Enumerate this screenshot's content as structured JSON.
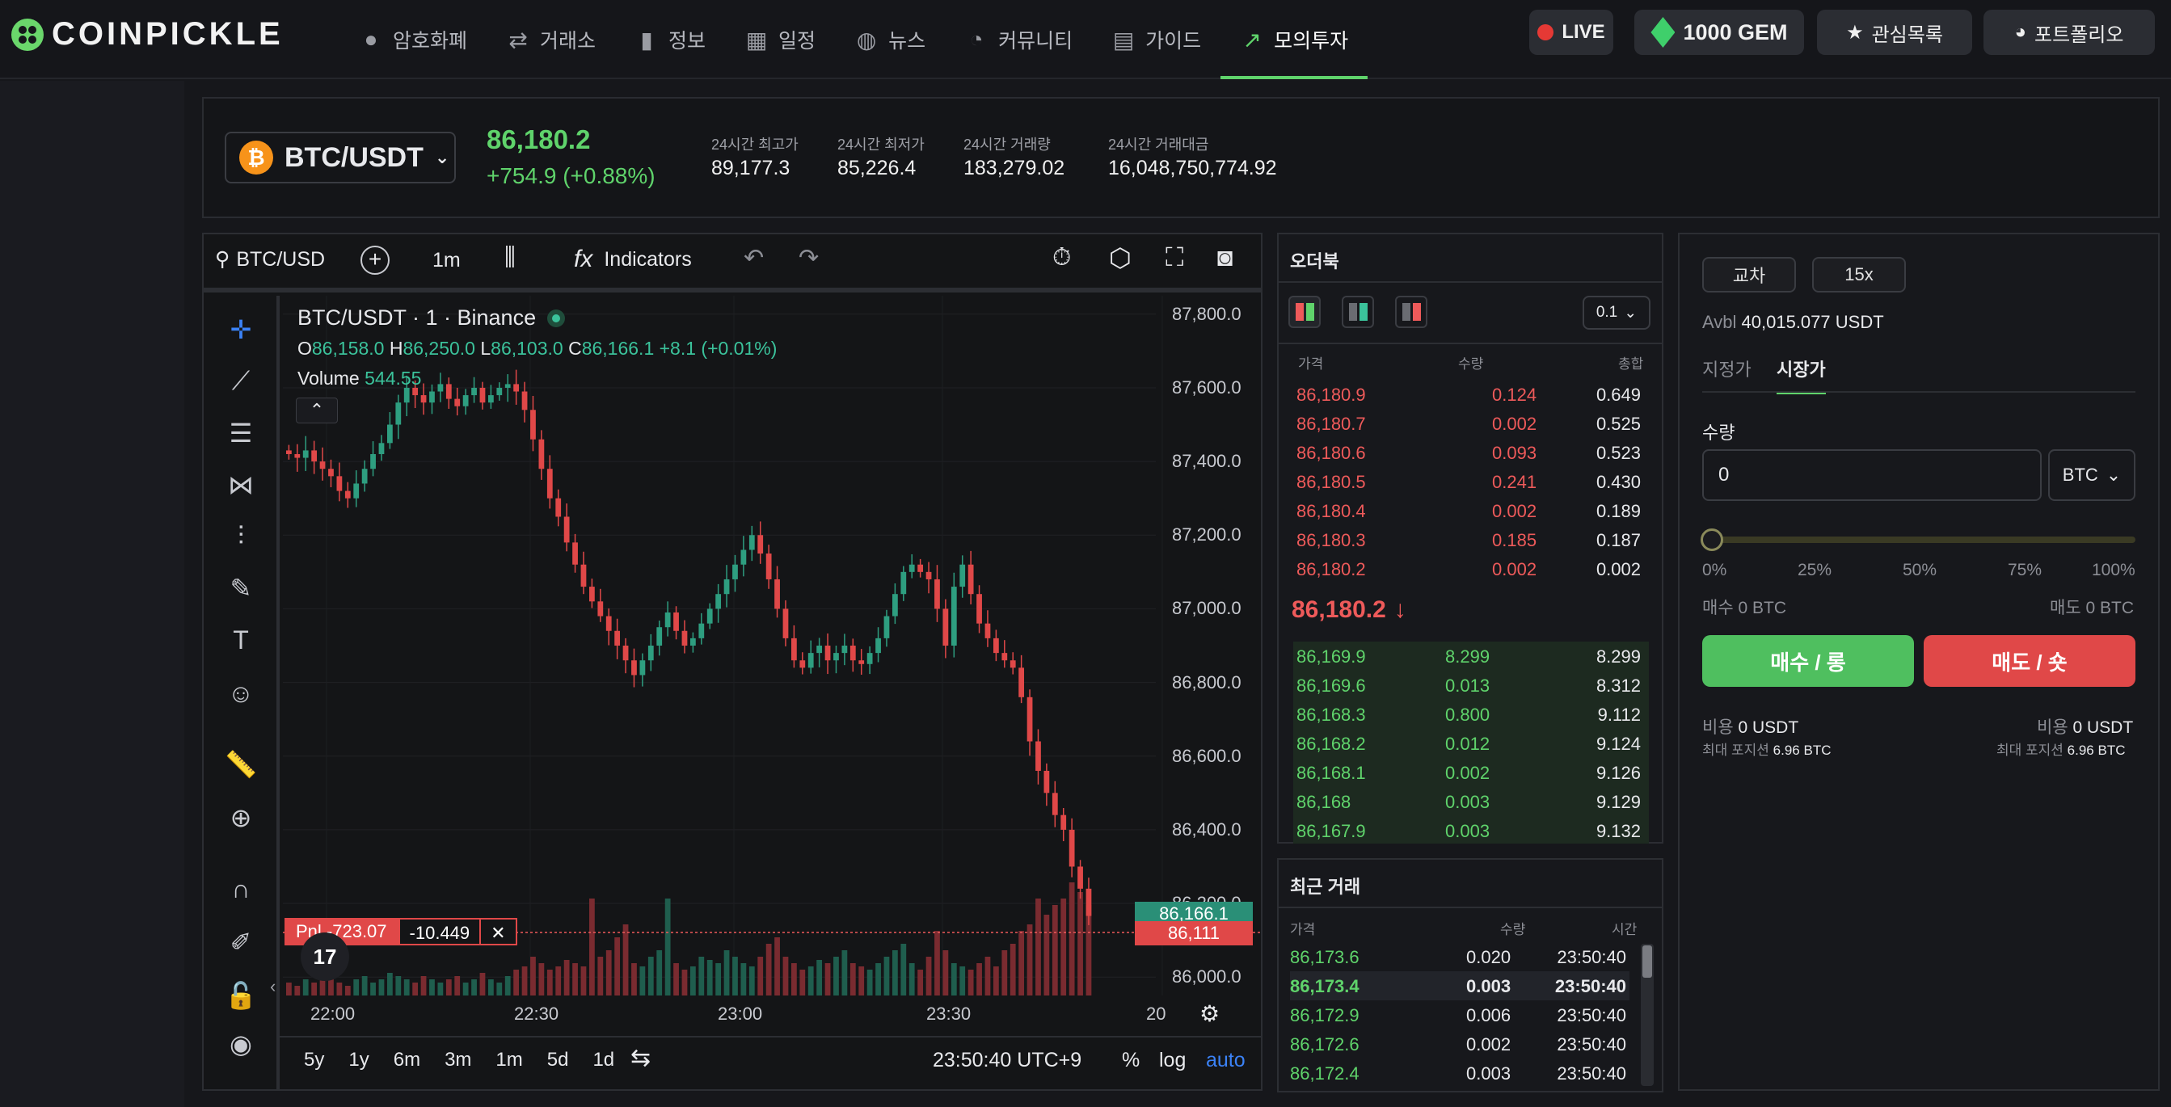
{
  "brand": {
    "name": "COINPICKLE"
  },
  "nav": [
    {
      "label": "암호화폐",
      "icon": "coins-icon"
    },
    {
      "label": "거래소",
      "icon": "exchange-icon"
    },
    {
      "label": "정보",
      "icon": "bar-chart-icon"
    },
    {
      "label": "일정",
      "icon": "calendar-icon"
    },
    {
      "label": "뉴스",
      "icon": "globe-icon"
    },
    {
      "label": "커뮤니티",
      "icon": "chat-icon"
    },
    {
      "label": "가이드",
      "icon": "guide-icon"
    },
    {
      "label": "모의투자",
      "icon": "trend-chart-icon",
      "active": true
    }
  ],
  "header_actions": {
    "live": "LIVE",
    "gem": "1000 GEM",
    "watchlist": "관심목록",
    "portfolio": "포트폴리오"
  },
  "ticker": {
    "pair": "BTC/USDT",
    "price": "86,180.2",
    "change": "+754.9 (+0.88%)",
    "stats": [
      {
        "label": "24시간 최고가",
        "value": "89,177.3"
      },
      {
        "label": "24시간 최저가",
        "value": "85,226.4"
      },
      {
        "label": "24시간 거래량",
        "value": "183,279.02"
      },
      {
        "label": "24시간 거래대금",
        "value": "16,048,750,774.92"
      }
    ]
  },
  "chart_toolbar": {
    "symbol": "BTC/USD",
    "interval": "1m",
    "indicators": "Indicators"
  },
  "chart_legend": {
    "title": "BTC/USDT · 1 · Binance",
    "o_label": "O",
    "o": "86,158.0",
    "h_label": "H",
    "h": "86,250.0",
    "l_label": "L",
    "l": "86,103.0",
    "c_label": "C",
    "c": "86,166.1",
    "chg": "+8.1 (+0.01%)",
    "volume_label": "Volume",
    "volume": "544.55"
  },
  "position_line": {
    "pnl": "Pnl -723.07",
    "qty": "-10.449"
  },
  "price_tags": {
    "last": "86,166.1",
    "entry": "86,111"
  },
  "chart_footer": {
    "ranges": [
      "5y",
      "1y",
      "6m",
      "3m",
      "1m",
      "5d",
      "1d"
    ],
    "time": "23:50:40 UTC+9",
    "pct": "%",
    "log": "log",
    "auto": "auto"
  },
  "chart_data": {
    "type": "candlestick",
    "x": [
      "22:00",
      "22:30",
      "23:00",
      "23:30",
      "20"
    ],
    "y_ticks": [
      "87,800.0",
      "87,600.0",
      "87,400.0",
      "87,200.0",
      "87,000.0",
      "86,800.0",
      "86,600.0",
      "86,400.0",
      "86,200.0",
      "86,000.0"
    ],
    "ylim": [
      85950,
      87850
    ],
    "close_series": [
      87420,
      87410,
      87430,
      87400,
      87380,
      87360,
      87320,
      87300,
      87340,
      87380,
      87420,
      87450,
      87500,
      87560,
      87600,
      87580,
      87560,
      87590,
      87610,
      87570,
      87550,
      87580,
      87600,
      87560,
      87580,
      87600,
      87610,
      87590,
      87540,
      87460,
      87380,
      87300,
      87250,
      87180,
      87120,
      87060,
      87020,
      86980,
      86940,
      86900,
      86860,
      86820,
      86860,
      86900,
      86950,
      86990,
      86940,
      86900,
      86920,
      86960,
      87000,
      87040,
      87080,
      87120,
      87160,
      87200,
      87150,
      87080,
      87000,
      86920,
      86860,
      86840,
      86880,
      86900,
      86860,
      86880,
      86900,
      86860,
      86850,
      86880,
      86920,
      86980,
      87040,
      87100,
      87120,
      87100,
      87080,
      87000,
      86900,
      87060,
      87120,
      87040,
      86960,
      86920,
      86880,
      86860,
      86840,
      86760,
      86640,
      86560,
      86500,
      86440,
      86400,
      86300,
      86240,
      86166
    ],
    "volume_series": [
      4,
      3,
      5,
      4,
      6,
      5,
      4,
      3,
      5,
      6,
      4,
      5,
      7,
      6,
      5,
      4,
      6,
      5,
      4,
      5,
      6,
      4,
      5,
      7,
      5,
      4,
      6,
      8,
      9,
      12,
      10,
      8,
      9,
      11,
      10,
      9,
      30,
      12,
      14,
      18,
      22,
      10,
      9,
      12,
      14,
      30,
      10,
      8,
      9,
      12,
      11,
      10,
      14,
      12,
      10,
      9,
      12,
      16,
      18,
      12,
      10,
      8,
      9,
      11,
      10,
      12,
      14,
      10,
      9,
      8,
      10,
      12,
      14,
      16,
      10,
      8,
      12,
      20,
      14,
      10,
      9,
      8,
      10,
      12,
      9,
      14,
      16,
      20,
      22,
      30,
      25,
      28,
      30,
      35,
      32,
      28
    ]
  },
  "orderbook": {
    "title": "오더북",
    "tick": "0.1",
    "headers": [
      "가격",
      "수량",
      "총합"
    ],
    "asks": [
      [
        "86,180.9",
        "0.124",
        "0.649"
      ],
      [
        "86,180.7",
        "0.002",
        "0.525"
      ],
      [
        "86,180.6",
        "0.093",
        "0.523"
      ],
      [
        "86,180.5",
        "0.241",
        "0.430"
      ],
      [
        "86,180.4",
        "0.002",
        "0.189"
      ],
      [
        "86,180.3",
        "0.185",
        "0.187"
      ],
      [
        "86,180.2",
        "0.002",
        "0.002"
      ]
    ],
    "mid": "86,180.2",
    "bids": [
      [
        "86,169.9",
        "8.299",
        "8.299"
      ],
      [
        "86,169.6",
        "0.013",
        "8.312"
      ],
      [
        "86,168.3",
        "0.800",
        "9.112"
      ],
      [
        "86,168.2",
        "0.012",
        "9.124"
      ],
      [
        "86,168.1",
        "0.002",
        "9.126"
      ],
      [
        "86,168",
        "0.003",
        "9.129"
      ],
      [
        "86,167.9",
        "0.003",
        "9.132"
      ]
    ]
  },
  "trades": {
    "title": "최근 거래",
    "headers": [
      "가격",
      "수량",
      "시간"
    ],
    "rows": [
      [
        "86,173.6",
        "0.020",
        "23:50:40"
      ],
      [
        "86,173.4",
        "0.003",
        "23:50:40"
      ],
      [
        "86,172.9",
        "0.006",
        "23:50:40"
      ],
      [
        "86,172.6",
        "0.002",
        "23:50:40"
      ],
      [
        "86,172.4",
        "0.003",
        "23:50:40"
      ]
    ]
  },
  "order_form": {
    "margin_mode": "교차",
    "leverage": "15x",
    "avbl_label": "Avbl",
    "avbl": "40,015.077 USDT",
    "tabs": [
      "지정가",
      "시장가"
    ],
    "qty_label": "수량",
    "qty_value": "0",
    "unit": "BTC",
    "slider_marks": [
      "0%",
      "25%",
      "50%",
      "75%",
      "100%"
    ],
    "slider_value": 0,
    "buy_amount": "매수 0 BTC",
    "sell_amount": "매도 0 BTC",
    "buy_button": "매수 / 롱",
    "sell_button": "매도 / 숏",
    "cost_label": "비용",
    "buy_cost": "0 USDT",
    "sell_cost": "0 USDT",
    "max_pos_label": "최대 포지션",
    "buy_max": "6.96 BTC",
    "sell_max": "6.96 BTC"
  }
}
